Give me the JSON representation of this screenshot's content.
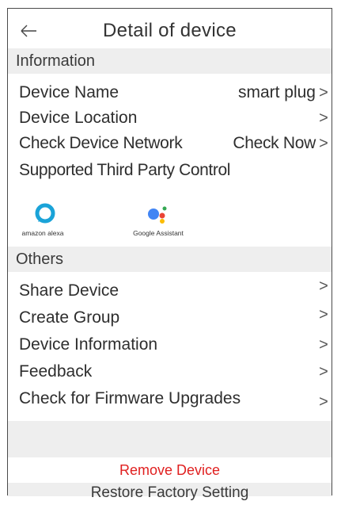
{
  "header": {
    "title": "Detail of device"
  },
  "information": {
    "section_label": "Information",
    "rows": [
      {
        "label": "Device Name",
        "value": "smart plug",
        "chevron": ">"
      },
      {
        "label": "Device Location",
        "value": "",
        "chevron": ">"
      },
      {
        "label": "Check Device Network",
        "value": "Check Now",
        "chevron": ">"
      }
    ],
    "third_party_label": "Supported Third Party Control",
    "third_party": [
      {
        "name": "amazon alexa",
        "icon": "alexa-ring-icon",
        "color": "#1aa3d8"
      },
      {
        "name": "Google Assistant",
        "icon": "google-assistant-dots-icon",
        "colors": [
          "#4285F4",
          "#EA4335",
          "#FBBC05",
          "#34A853"
        ]
      }
    ]
  },
  "others": {
    "section_label": "Others",
    "rows": [
      {
        "label": "Share Device",
        "chevron": ">"
      },
      {
        "label": "Create Group",
        "chevron": ">"
      },
      {
        "label": "Device Information",
        "chevron": ">"
      },
      {
        "label": "Feedback",
        "chevron": ">"
      },
      {
        "label": "Check for Firmware Upgrades",
        "chevron": ">"
      }
    ]
  },
  "actions": {
    "remove_label": "Remove Device",
    "remove_color": "#e02020",
    "restore_label": "Restore Factory Setting"
  }
}
